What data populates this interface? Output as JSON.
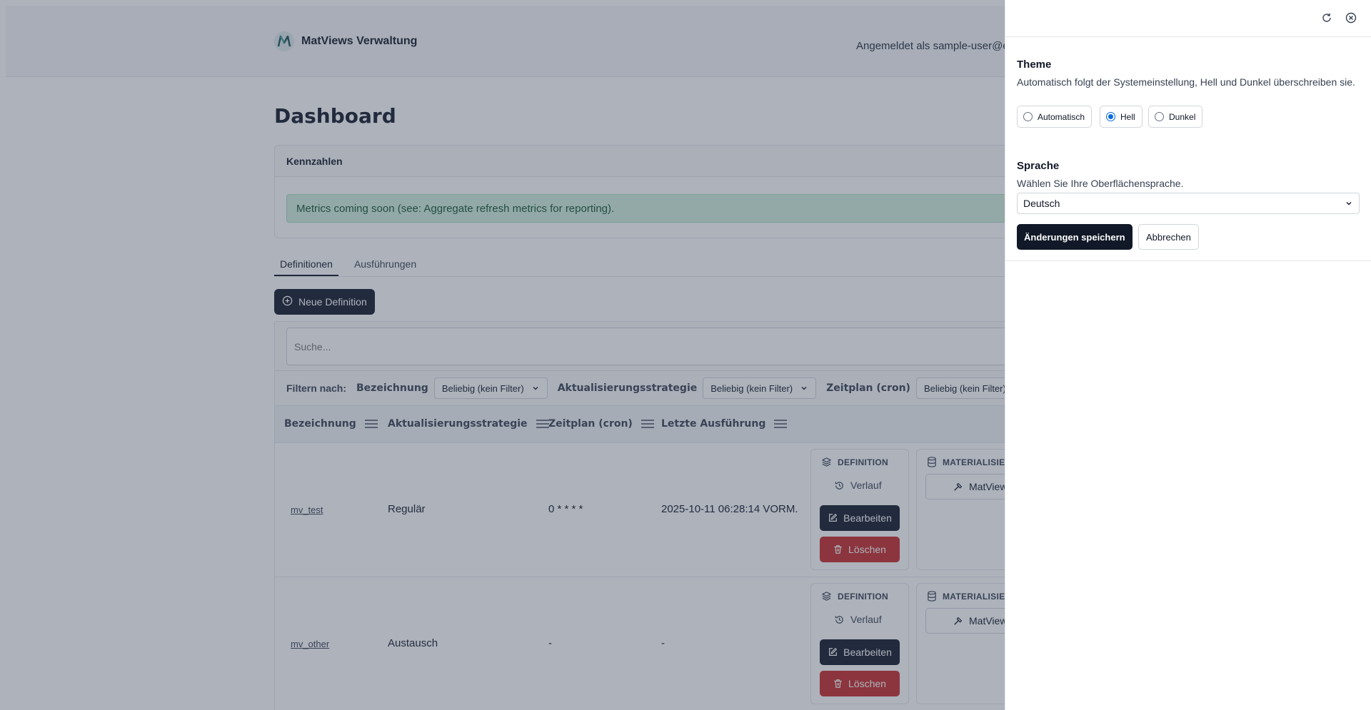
{
  "header": {
    "app_name": "MatViews Verwaltung",
    "user_label": "Angemeldet als sample-user@e"
  },
  "page": {
    "title": "Dashboard"
  },
  "metrics": {
    "card_title": "Kennzahlen",
    "alert_text": "Metrics coming soon (see: Aggregate refresh metrics for reporting)."
  },
  "tabs": [
    {
      "label": "Definitionen",
      "active": true
    },
    {
      "label": "Ausführungen",
      "active": false
    }
  ],
  "toolbar": {
    "new_definition_label": "Neue Definition"
  },
  "search": {
    "placeholder": "Suche..."
  },
  "filters": {
    "title": "Filtern nach:",
    "items": [
      {
        "label": "Bezeichnung",
        "value": "Beliebig (kein Filter)"
      },
      {
        "label": "Aktualisierungsstrategie",
        "value": "Beliebig (kein Filter)"
      },
      {
        "label": "Zeitplan (cron)",
        "value": "Beliebig (kein Filter)"
      }
    ]
  },
  "table": {
    "columns": [
      "Bezeichnung",
      "Aktualisierungsstrategie",
      "Zeitplan (cron)",
      "Letzte Ausführung"
    ],
    "rows": [
      {
        "name": "mv_test",
        "strategy": "Regulär",
        "schedule": "0 * * * *",
        "last_run": "2025-10-11 06:28:14 VORM."
      },
      {
        "name": "mv_other",
        "strategy": "Austausch",
        "schedule": "-",
        "last_run": "-"
      }
    ],
    "actions": {
      "definition_header": "DEFINITION",
      "history_label": "Verlauf",
      "edit_label": "Bearbeiten",
      "delete_label": "Löschen",
      "materialize_header": "MATERIALISIEI",
      "matview_label": "MatView"
    }
  },
  "settings_drawer": {
    "theme": {
      "title": "Theme",
      "description": "Automatisch folgt der Systemeinstellung, Hell und Dunkel überschreiben sie.",
      "options": [
        {
          "label": "Automatisch",
          "checked": false
        },
        {
          "label": "Hell",
          "checked": true
        },
        {
          "label": "Dunkel",
          "checked": false
        }
      ]
    },
    "language": {
      "title": "Sprache",
      "description": "Wählen Sie Ihre Oberflächensprache.",
      "selected": "Deutsch"
    },
    "save_label": "Änderungen speichern",
    "cancel_label": "Abbrechen"
  },
  "colors": {
    "primary": "#111827",
    "danger": "#c62828",
    "success_bg": "#d1f0de",
    "radio_accent": "#0b6bdc"
  }
}
